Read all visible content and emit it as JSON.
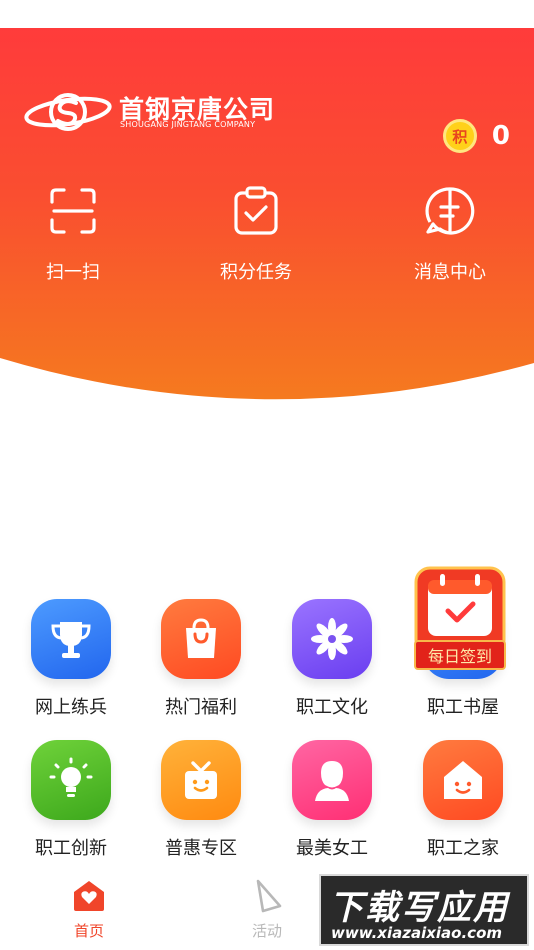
{
  "brand": {
    "name": "首钢京唐公司",
    "subtitle": "SHOUGANG JINGTANG COMPANY"
  },
  "points": {
    "badge": "积",
    "value": "0"
  },
  "quick_actions": [
    {
      "label": "扫一扫",
      "icon": "scan-icon"
    },
    {
      "label": "积分任务",
      "icon": "clipboard-check-icon"
    },
    {
      "label": "消息中心",
      "icon": "message-icon"
    }
  ],
  "grid": [
    {
      "label": "网上练兵",
      "icon": "trophy-icon",
      "color": "#2f7bf5"
    },
    {
      "label": "热门福利",
      "icon": "shopping-bag-icon",
      "color": "#ff5a2c"
    },
    {
      "label": "职工文化",
      "icon": "flower-icon",
      "color": "#7a52f0"
    },
    {
      "label": "职工书屋",
      "icon": "book-icon",
      "color": "#2f7bf5"
    },
    {
      "label": "职工创新",
      "icon": "lightbulb-icon",
      "color": "#4fbf2a"
    },
    {
      "label": "普惠专区",
      "icon": "gift-icon",
      "color": "#ff9a1a"
    },
    {
      "label": "最美女工",
      "icon": "woman-icon",
      "color": "#ff3f86"
    },
    {
      "label": "职工之家",
      "icon": "home-icon",
      "color": "#ff5a2c"
    }
  ],
  "signin": {
    "label": "每日签到"
  },
  "tabs": [
    {
      "label": "首页",
      "active": true,
      "icon": "home-heart-icon"
    },
    {
      "label": "活动",
      "active": false,
      "icon": "activity-icon"
    }
  ],
  "watermark": {
    "title": "下载写应用",
    "url": "www.xiazaixiao.com"
  },
  "colors": {
    "hero_top": "#ff3b3b",
    "hero_bottom": "#f57a1f",
    "tab_active": "#f0452a",
    "tab_inactive": "#b8b8b8"
  }
}
